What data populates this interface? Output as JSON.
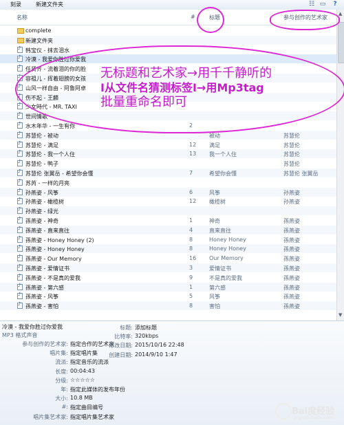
{
  "toolbar": {
    "share": "刻录",
    "new_folder": "新建文件夹"
  },
  "columns": {
    "name": "名称",
    "num": "#",
    "title": "标题",
    "artist": "参与创作的艺术家"
  },
  "rows": [
    {
      "icon": "folder",
      "name": "complete",
      "num": "",
      "title": "",
      "artist": ""
    },
    {
      "icon": "folder",
      "name": "新建文件夹",
      "num": "",
      "title": "",
      "artist": ""
    },
    {
      "icon": "file",
      "name": "韩宝仪 - 抹去泪水",
      "num": "",
      "title": "",
      "artist": ""
    },
    {
      "icon": "file",
      "name": "冷漠 - 我爱你胜过你爱我",
      "num": "",
      "title": "",
      "artist": ""
    },
    {
      "icon": "file",
      "name": "任贤齐 - 流着泪的你的脸",
      "num": "",
      "title": "",
      "artist": ""
    },
    {
      "icon": "file",
      "name": "容祖儿 - 挥着翅膀的女孩",
      "num": "",
      "title": "",
      "artist": ""
    },
    {
      "icon": "file",
      "name": "山风一样自由 - 阿鲁阿卓",
      "num": "",
      "title": "",
      "artist": ""
    },
    {
      "icon": "file",
      "name": "伤不起 - 王麟",
      "num": "",
      "title": "",
      "artist": ""
    },
    {
      "icon": "file",
      "name": "少女時代 - MR. TAXI",
      "num": "",
      "title": "",
      "artist": ""
    },
    {
      "icon": "file",
      "name": "世间情歌",
      "num": "",
      "title": "",
      "artist": ""
    },
    {
      "icon": "file",
      "name": "水木年华 - 一生有你",
      "num": "2",
      "title": "",
      "artist": ""
    },
    {
      "icon": "file",
      "name": "苏慧伦 - 被动",
      "num": "",
      "title": "被动",
      "artist": "苏慧伦"
    },
    {
      "icon": "file",
      "name": "苏慧伦 - 满足",
      "num": "12",
      "title": "满足",
      "artist": "苏慧伦"
    },
    {
      "icon": "file",
      "name": "苏慧伦 - 我一个人住",
      "num": "13",
      "title": "我一个人住",
      "artist": "苏慧伦"
    },
    {
      "icon": "file",
      "name": "苏慧伦 - 鸭子",
      "num": "",
      "title": "",
      "artist": "苏慧伦"
    },
    {
      "icon": "file",
      "name": "苏慧伦 张翼岳 - 希望你会懂",
      "num": "7",
      "title": "希望你会懂",
      "artist": "苏慧伦 张翼岳"
    },
    {
      "icon": "file",
      "name": "苏芮 - 一样的月亮",
      "num": "",
      "title": "",
      "artist": ""
    },
    {
      "icon": "file",
      "name": "孙燕姿 - 风筝",
      "num": "6",
      "title": "风筝",
      "artist": "孙燕姿"
    },
    {
      "icon": "file",
      "name": "孙燕姿 - 橄榄树",
      "num": "12",
      "title": "橄榄树",
      "artist": "孙燕姿"
    },
    {
      "icon": "file",
      "name": "孙燕姿 - 绿光",
      "num": "",
      "title": "",
      "artist": ""
    },
    {
      "icon": "file",
      "name": "孫燕姿 - 神奇",
      "num": "1",
      "title": "神奇",
      "artist": "孫燕姿"
    },
    {
      "icon": "file",
      "name": "孫燕姿 - 直来直往",
      "num": "4",
      "title": "直来直往",
      "artist": "孫燕姿"
    },
    {
      "icon": "file",
      "name": "孫燕姿 - Honey Honey (2)",
      "num": "8",
      "title": "Honey Honey",
      "artist": "孫燕姿"
    },
    {
      "icon": "file",
      "name": "孫燕姿 - Honey Honey",
      "num": "8",
      "title": "Honey Honey",
      "artist": "孫燕姿"
    },
    {
      "icon": "file",
      "name": "孫燕姿 - Our Memory",
      "num": "16",
      "title": "Our Memory",
      "artist": "孫燕姿"
    },
    {
      "icon": "file",
      "name": "孫燕姿 - 爱情证书",
      "num": "3",
      "title": "爱情证书",
      "artist": "孫燕姿"
    },
    {
      "icon": "file",
      "name": "孫燕姿 - 不是真的爱我",
      "num": "9",
      "title": "不是真的爱我",
      "artist": "孫燕姿"
    },
    {
      "icon": "file",
      "name": "孫燕姿 - 第六感",
      "num": "1",
      "title": "第六感",
      "artist": "孫燕姿"
    },
    {
      "icon": "file",
      "name": "孫燕姿 - 风筝",
      "num": "5",
      "title": "风筝",
      "artist": "孫燕姿"
    },
    {
      "icon": "file",
      "name": "孫燕姿 - 害怕",
      "num": "8",
      "title": "害怕",
      "artist": "孫燕姿"
    }
  ],
  "annotation": {
    "line1": "无标题和艺术家→用千千静听的",
    "line2": "I从文件名猜测标签I→用Mp3tag",
    "line3": "批量重命名即可"
  },
  "details": {
    "filename": "冷漠 - 我爱你胜过你爱我",
    "filetype": "MP3 格式声音",
    "left": [
      {
        "k": "参与创作的艺术家:",
        "v": "指定合作的艺术家"
      },
      {
        "k": "唱片集:",
        "v": "指定唱片集"
      },
      {
        "k": "流派:",
        "v": "指定音乐的流派"
      },
      {
        "k": "长度:",
        "v": "00:04:43"
      },
      {
        "k": "分级:",
        "v": "☆☆☆☆☆"
      },
      {
        "k": "年:",
        "v": "指定此媒体的发布年份"
      },
      {
        "k": "大小:",
        "v": "10.8 MB"
      },
      {
        "k": "#:",
        "v": "指定曲目编号"
      },
      {
        "k": "唱片集艺术家:",
        "v": "指定唱片集艺术家"
      }
    ],
    "right": [
      {
        "k": "标题:",
        "v": "添加标题"
      },
      {
        "k": "比特率:",
        "v": "320kbps"
      },
      {
        "k": "修改日期:",
        "v": "2015/10/16 22:48"
      },
      {
        "k": "创建日期:",
        "v": "2014/9/10 1:47"
      }
    ]
  },
  "watermark": {
    "text": "Bai度经验",
    "sub": "jingyan.baidu.com"
  },
  "colors": {
    "annotation": "#dd27d6",
    "selected_row": "#dceaf9"
  }
}
